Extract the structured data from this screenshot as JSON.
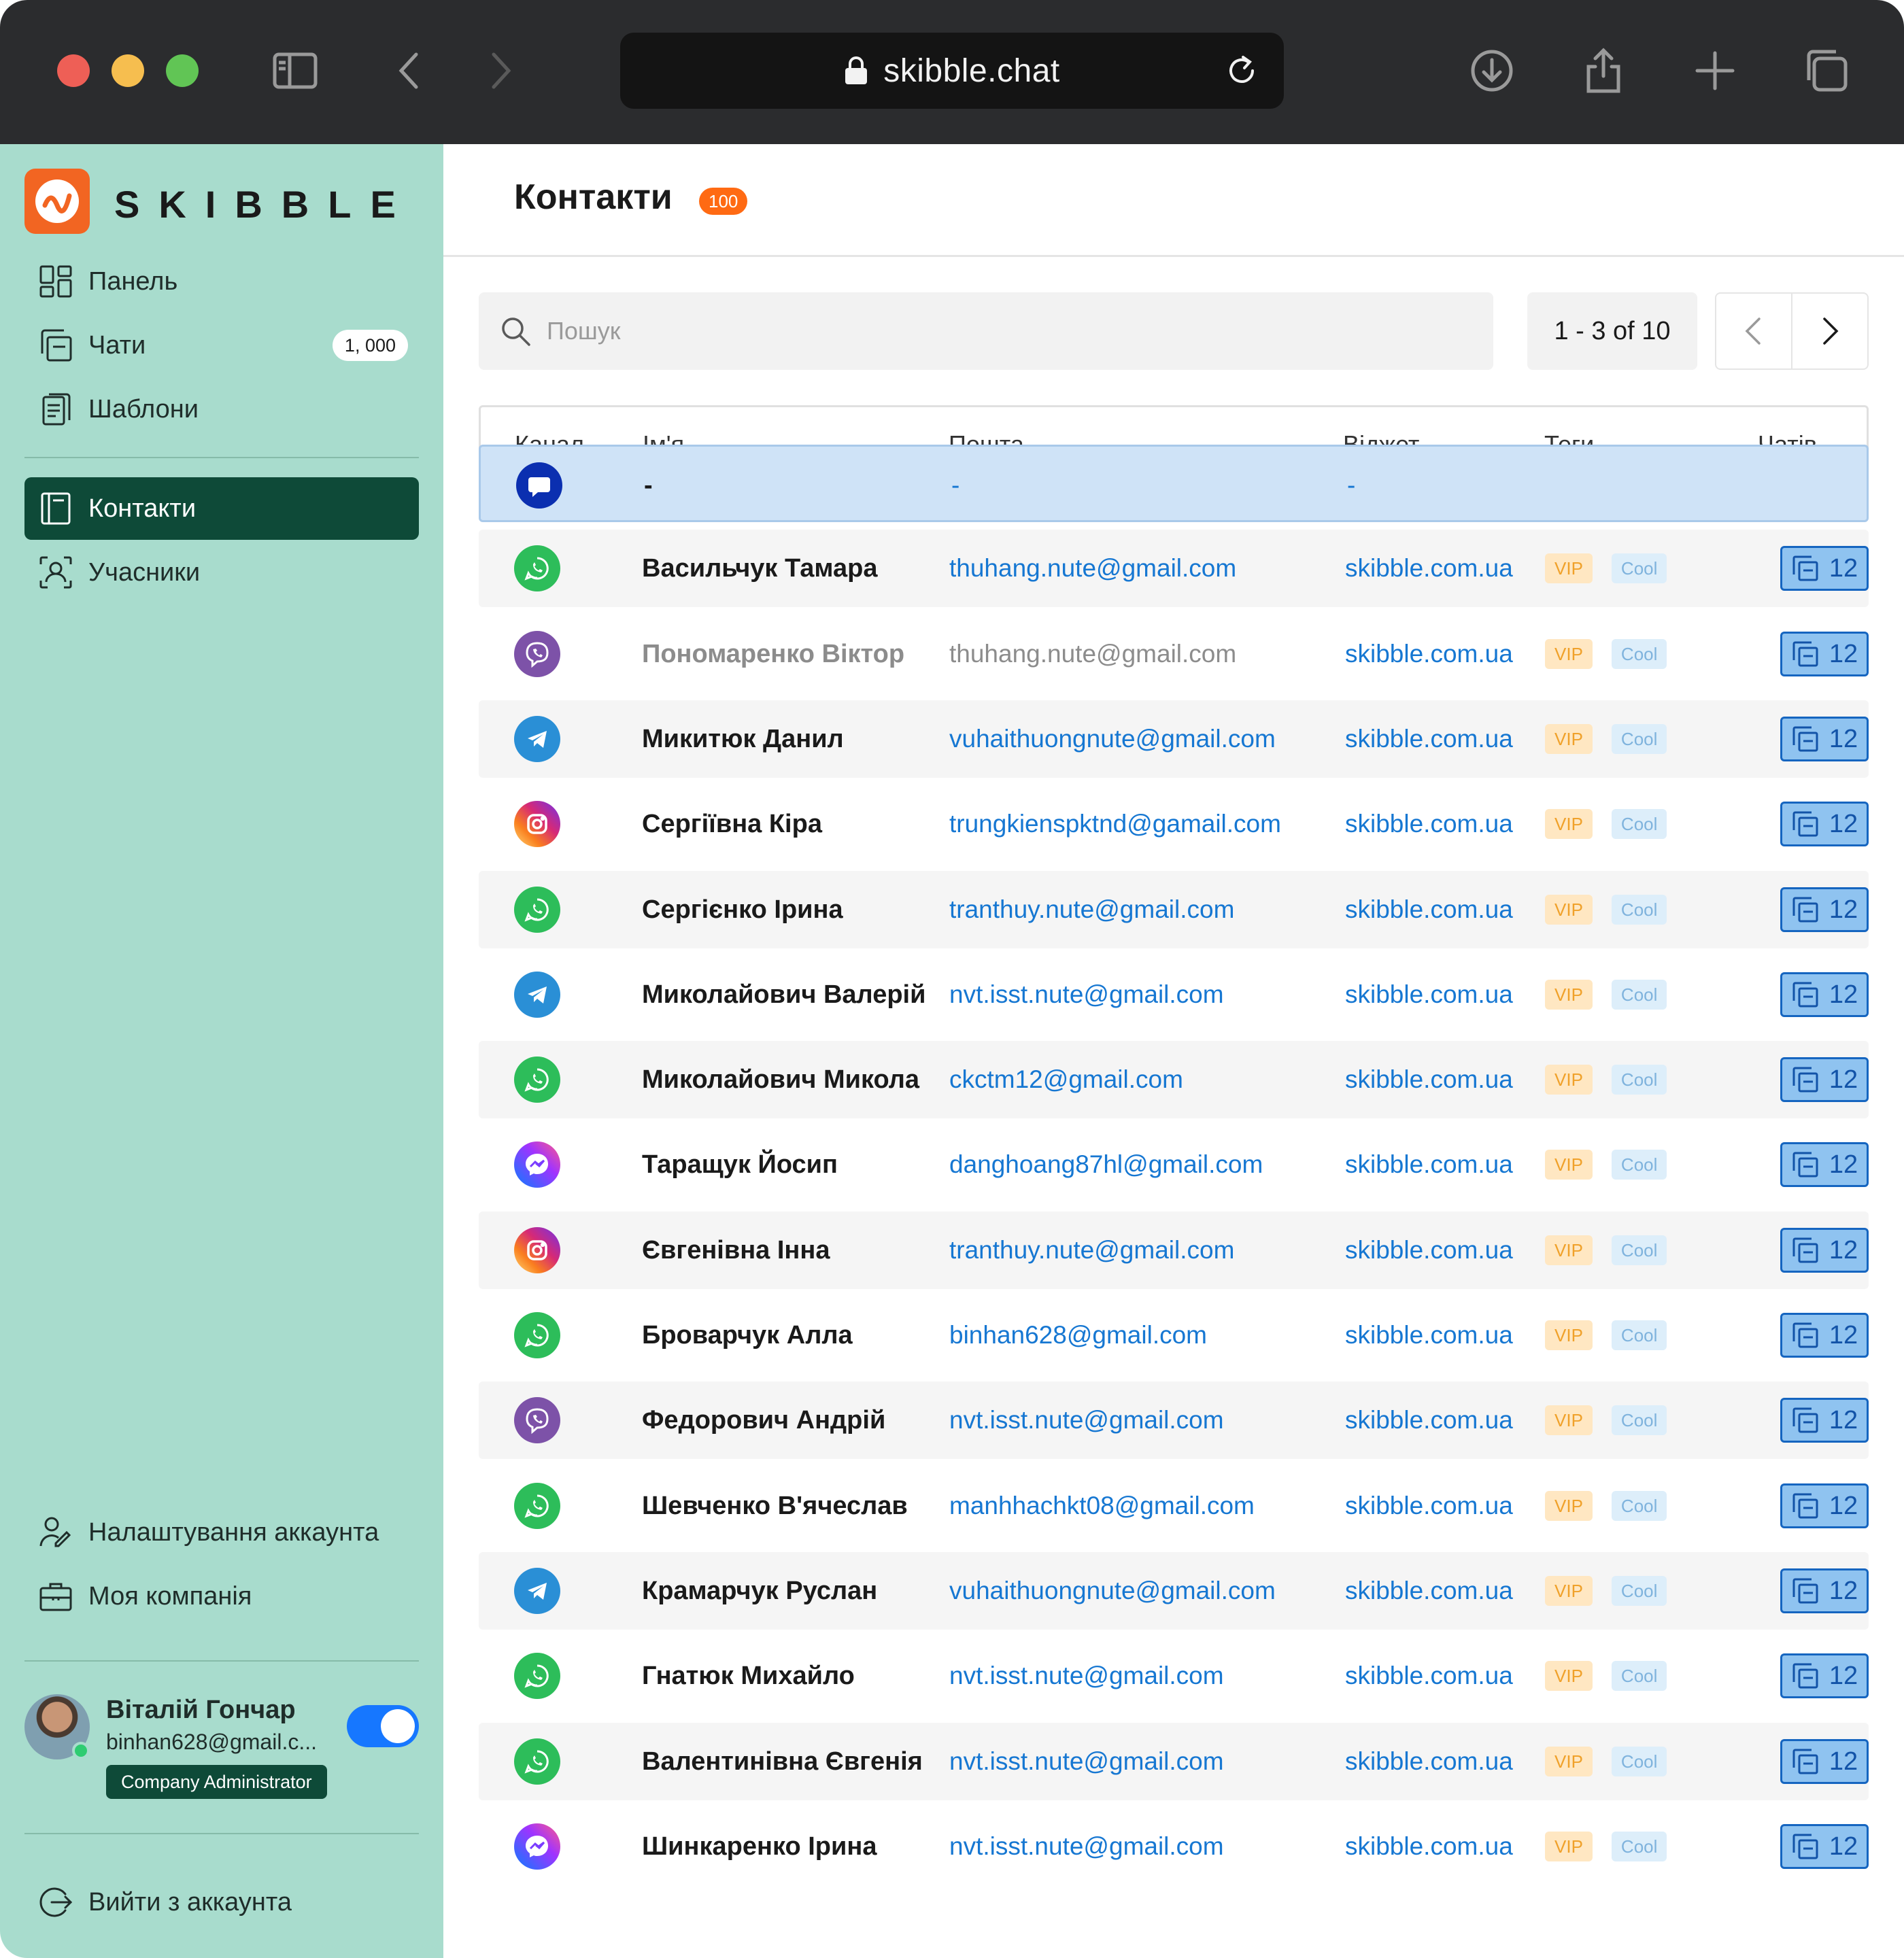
{
  "browser": {
    "url": "skibble.chat"
  },
  "sidebar": {
    "logo_text": "SKIBBLE",
    "nav": [
      {
        "label": "Панель",
        "icon": "dashboard-icon"
      },
      {
        "label": "Чати",
        "icon": "chats-icon",
        "badge": "1, 000"
      },
      {
        "label": "Шаблони",
        "icon": "templates-icon"
      },
      {
        "label": "Контакти",
        "icon": "contacts-icon",
        "active": true
      },
      {
        "label": "Учасники",
        "icon": "members-icon"
      }
    ],
    "bottom_nav": [
      {
        "label": "Налаштування аккаунта",
        "icon": "account-settings-icon"
      },
      {
        "label": "Моя компанія",
        "icon": "briefcase-icon"
      }
    ],
    "profile": {
      "name": "Віталій Гончар",
      "email": "binhan628@gmail.c...",
      "role": "Company Administrator"
    },
    "logout_label": "Вийти з аккаунта"
  },
  "main": {
    "title": "Контакти",
    "title_badge": "100",
    "search_placeholder": "Пошук",
    "pagination": "1 - 3 of 10",
    "columns": {
      "channel": "Канал",
      "name": "Ім'я",
      "email": "Пошта",
      "widget": "Віджет",
      "tags": "Теги",
      "chats": "Чатів"
    },
    "rows": [
      {
        "channel": "chat",
        "name": "-",
        "email": "-",
        "widget": "-",
        "tags": [],
        "chats": ""
      },
      {
        "channel": "whatsapp",
        "name": "Васильчук Тамара",
        "email": "thuhang.nute@gmail.com",
        "widget": "skibble.com.ua",
        "tags": [
          "VIP",
          "Cool"
        ],
        "chats": "12"
      },
      {
        "channel": "viber",
        "name": "Пономаренко Віктор",
        "email": "thuhang.nute@gmail.com",
        "widget": "skibble.com.ua",
        "tags": [
          "VIP",
          "Cool"
        ],
        "chats": "12",
        "muted": true
      },
      {
        "channel": "telegram",
        "name": "Микитюк Данил",
        "email": "vuhaithuongnute@gmail.com",
        "widget": "skibble.com.ua",
        "tags": [
          "VIP",
          "Cool"
        ],
        "chats": "12"
      },
      {
        "channel": "instagram",
        "name": "Сергіївна Кіра",
        "email": "trungkienspktnd@gamail.com",
        "widget": "skibble.com.ua",
        "tags": [
          "VIP",
          "Cool"
        ],
        "chats": "12"
      },
      {
        "channel": "whatsapp",
        "name": "Сергієнко Ірина",
        "email": "tranthuy.nute@gmail.com",
        "widget": "skibble.com.ua",
        "tags": [
          "VIP",
          "Cool"
        ],
        "chats": "12"
      },
      {
        "channel": "telegram",
        "name": "Миколайович Валерій",
        "email": "nvt.isst.nute@gmail.com",
        "widget": "skibble.com.ua",
        "tags": [
          "VIP",
          "Cool"
        ],
        "chats": "12"
      },
      {
        "channel": "whatsapp",
        "name": "Миколайович Микола",
        "email": "ckctm12@gmail.com",
        "widget": "skibble.com.ua",
        "tags": [
          "VIP",
          "Cool"
        ],
        "chats": "12"
      },
      {
        "channel": "messenger",
        "name": "Таращук Йосип",
        "email": "danghoang87hl@gmail.com",
        "widget": "skibble.com.ua",
        "tags": [
          "VIP",
          "Cool"
        ],
        "chats": "12"
      },
      {
        "channel": "instagram",
        "name": "Євгенівна Інна",
        "email": "tranthuy.nute@gmail.com",
        "widget": "skibble.com.ua",
        "tags": [
          "VIP",
          "Cool"
        ],
        "chats": "12"
      },
      {
        "channel": "whatsapp",
        "name": "Броварчук Алла",
        "email": "binhan628@gmail.com",
        "widget": "skibble.com.ua",
        "tags": [
          "VIP",
          "Cool"
        ],
        "chats": "12"
      },
      {
        "channel": "viber",
        "name": "Федорович Андрій",
        "email": "nvt.isst.nute@gmail.com",
        "widget": "skibble.com.ua",
        "tags": [
          "VIP",
          "Cool"
        ],
        "chats": "12"
      },
      {
        "channel": "whatsapp",
        "name": "Шевченко В'ячеслав",
        "email": "manhhachkt08@gmail.com",
        "widget": "skibble.com.ua",
        "tags": [
          "VIP",
          "Cool"
        ],
        "chats": "12"
      },
      {
        "channel": "telegram",
        "name": "Крамарчук Руслан",
        "email": "vuhaithuongnute@gmail.com",
        "widget": "skibble.com.ua",
        "tags": [
          "VIP",
          "Cool"
        ],
        "chats": "12"
      },
      {
        "channel": "whatsapp",
        "name": "Гнатюк Михайло",
        "email": "nvt.isst.nute@gmail.com",
        "widget": "skibble.com.ua",
        "tags": [
          "VIP",
          "Cool"
        ],
        "chats": "12"
      },
      {
        "channel": "whatsapp",
        "name": "Валентинівна Євгенія",
        "email": "nvt.isst.nute@gmail.com",
        "widget": "skibble.com.ua",
        "tags": [
          "VIP",
          "Cool"
        ],
        "chats": "12"
      },
      {
        "channel": "messenger",
        "name": "Шинкаренко Ірина",
        "email": "nvt.isst.nute@gmail.com",
        "widget": "skibble.com.ua",
        "tags": [
          "VIP",
          "Cool"
        ],
        "chats": "12"
      }
    ]
  },
  "colors": {
    "sidebar_bg": "#a8dccd",
    "active_nav": "#0e4a38",
    "brand_orange": "#f26522",
    "link_blue": "#1677d2",
    "selected_row": "#cfe3f7"
  }
}
